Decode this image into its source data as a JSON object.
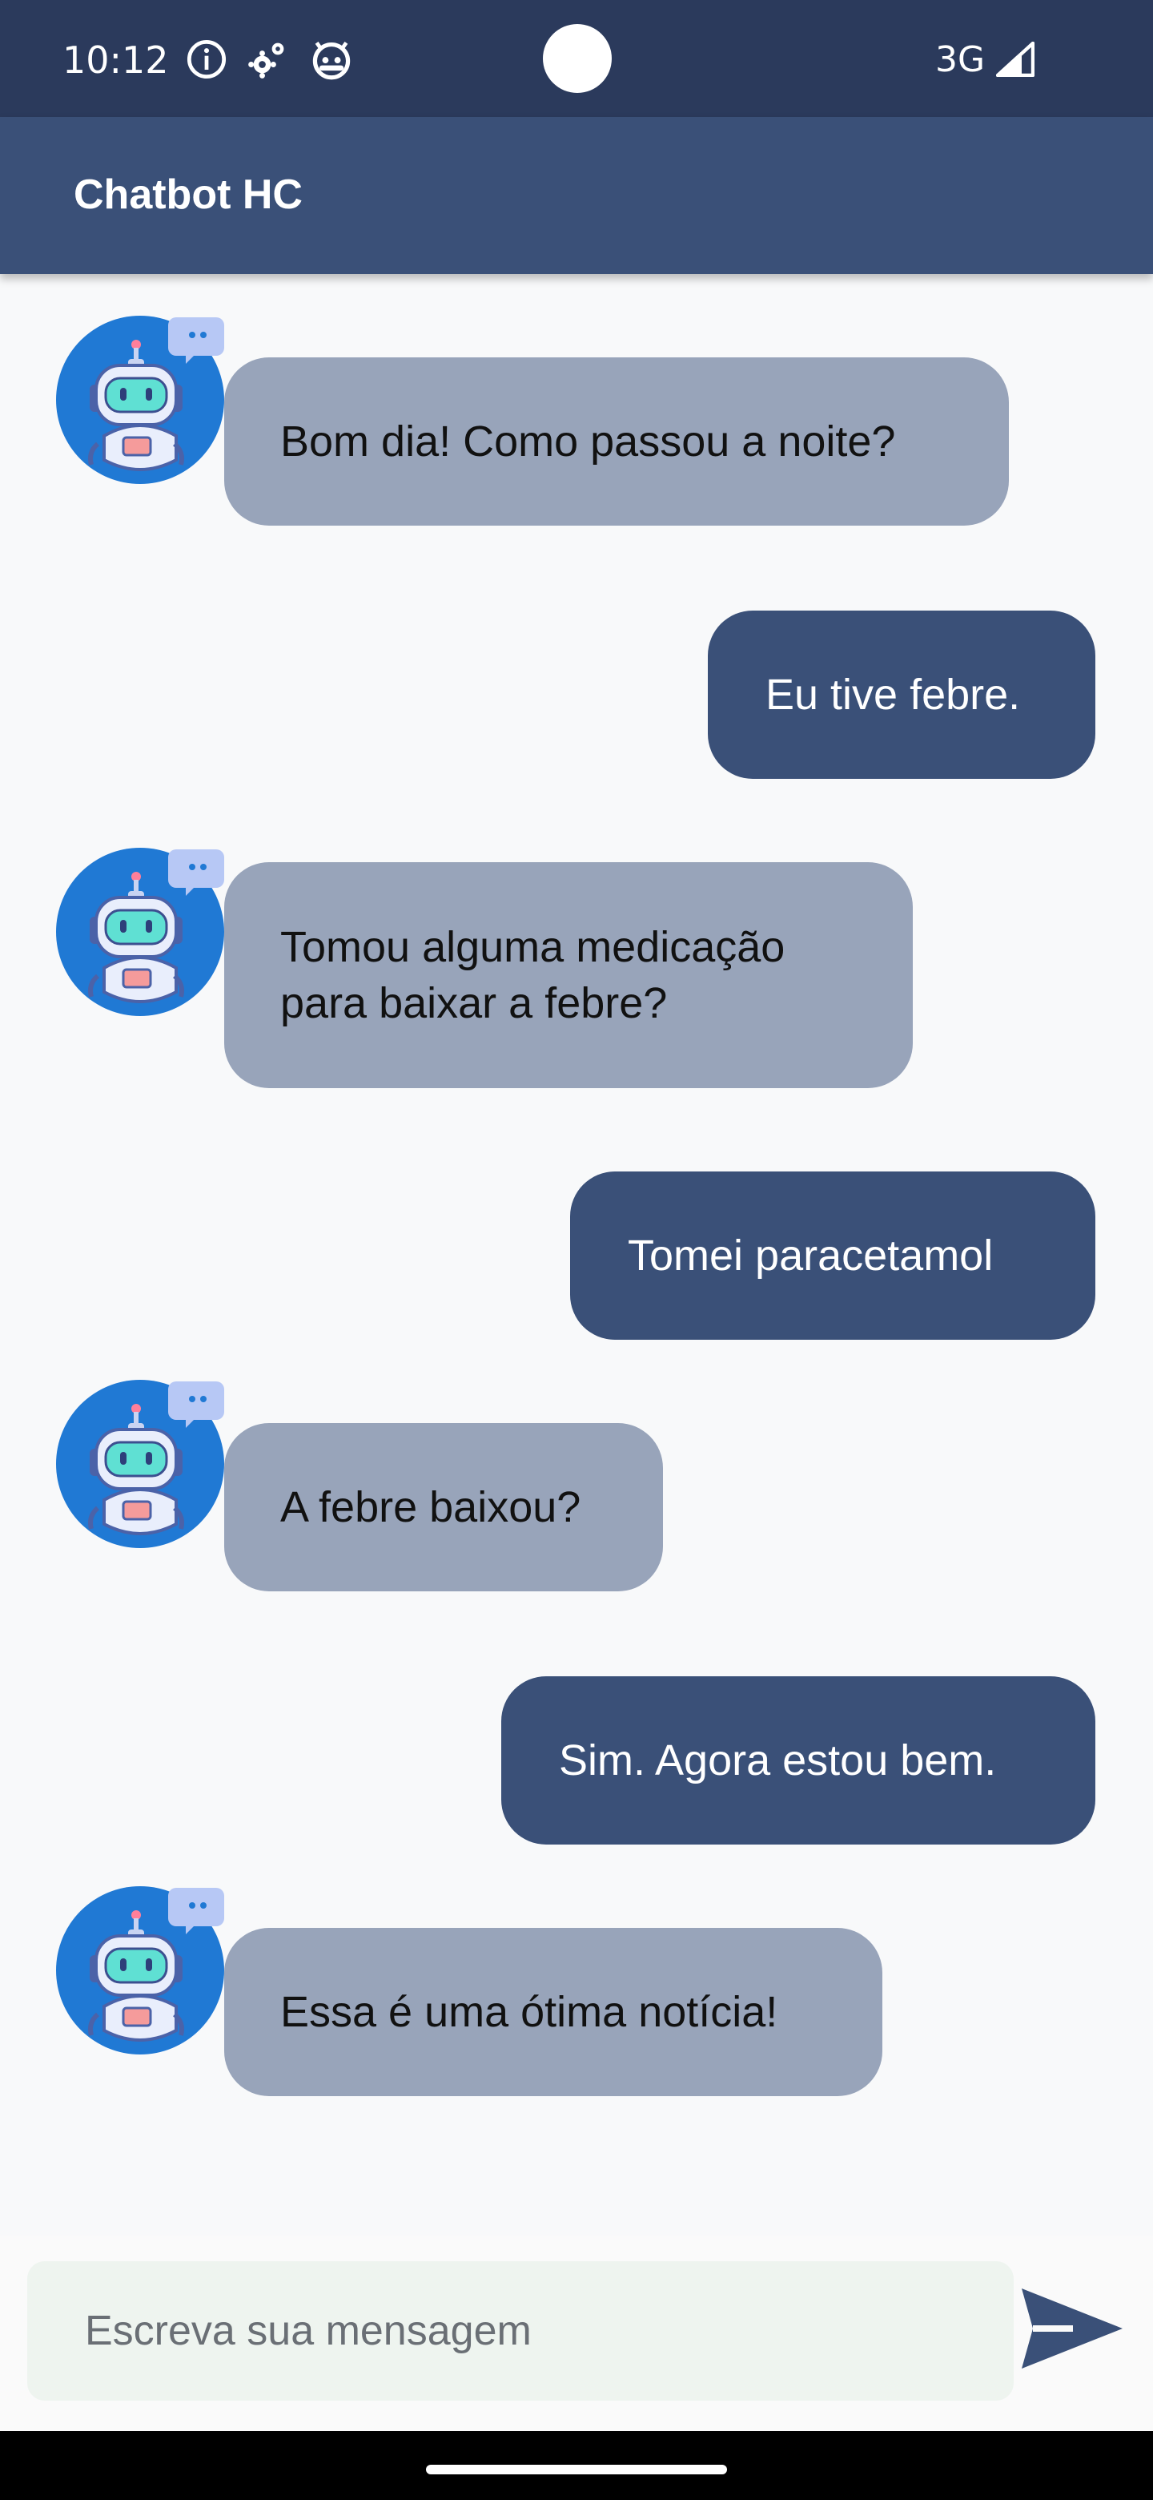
{
  "status_bar": {
    "time": "10:12",
    "icons": [
      "info-icon",
      "settings-icon",
      "android-robot-icon"
    ],
    "network": "3G",
    "signal_icon": "cellular-signal-icon"
  },
  "app_bar": {
    "title": "Chatbot HC"
  },
  "messages": [
    {
      "sender": "bot",
      "text": "Bom dia! Como passou a noite?"
    },
    {
      "sender": "user",
      "text": "Eu tive febre."
    },
    {
      "sender": "bot",
      "text": "Tomou alguma medicação para baixar a febre?"
    },
    {
      "sender": "user",
      "text": "Tomei paracetamol"
    },
    {
      "sender": "bot",
      "text": "A febre baixou?"
    },
    {
      "sender": "user",
      "text": "Sim. Agora estou bem."
    },
    {
      "sender": "bot",
      "text": "Essa é uma ótima notícia!"
    }
  ],
  "input": {
    "placeholder": "Escreva sua mensagem",
    "value": "",
    "send_icon": "send-icon"
  },
  "colors": {
    "status_bar": "#2b3a5c",
    "app_bar": "#3a5078",
    "bot_bubble": "#98a4ba",
    "user_bubble": "#3a5078",
    "background": "#f8f9fa"
  }
}
